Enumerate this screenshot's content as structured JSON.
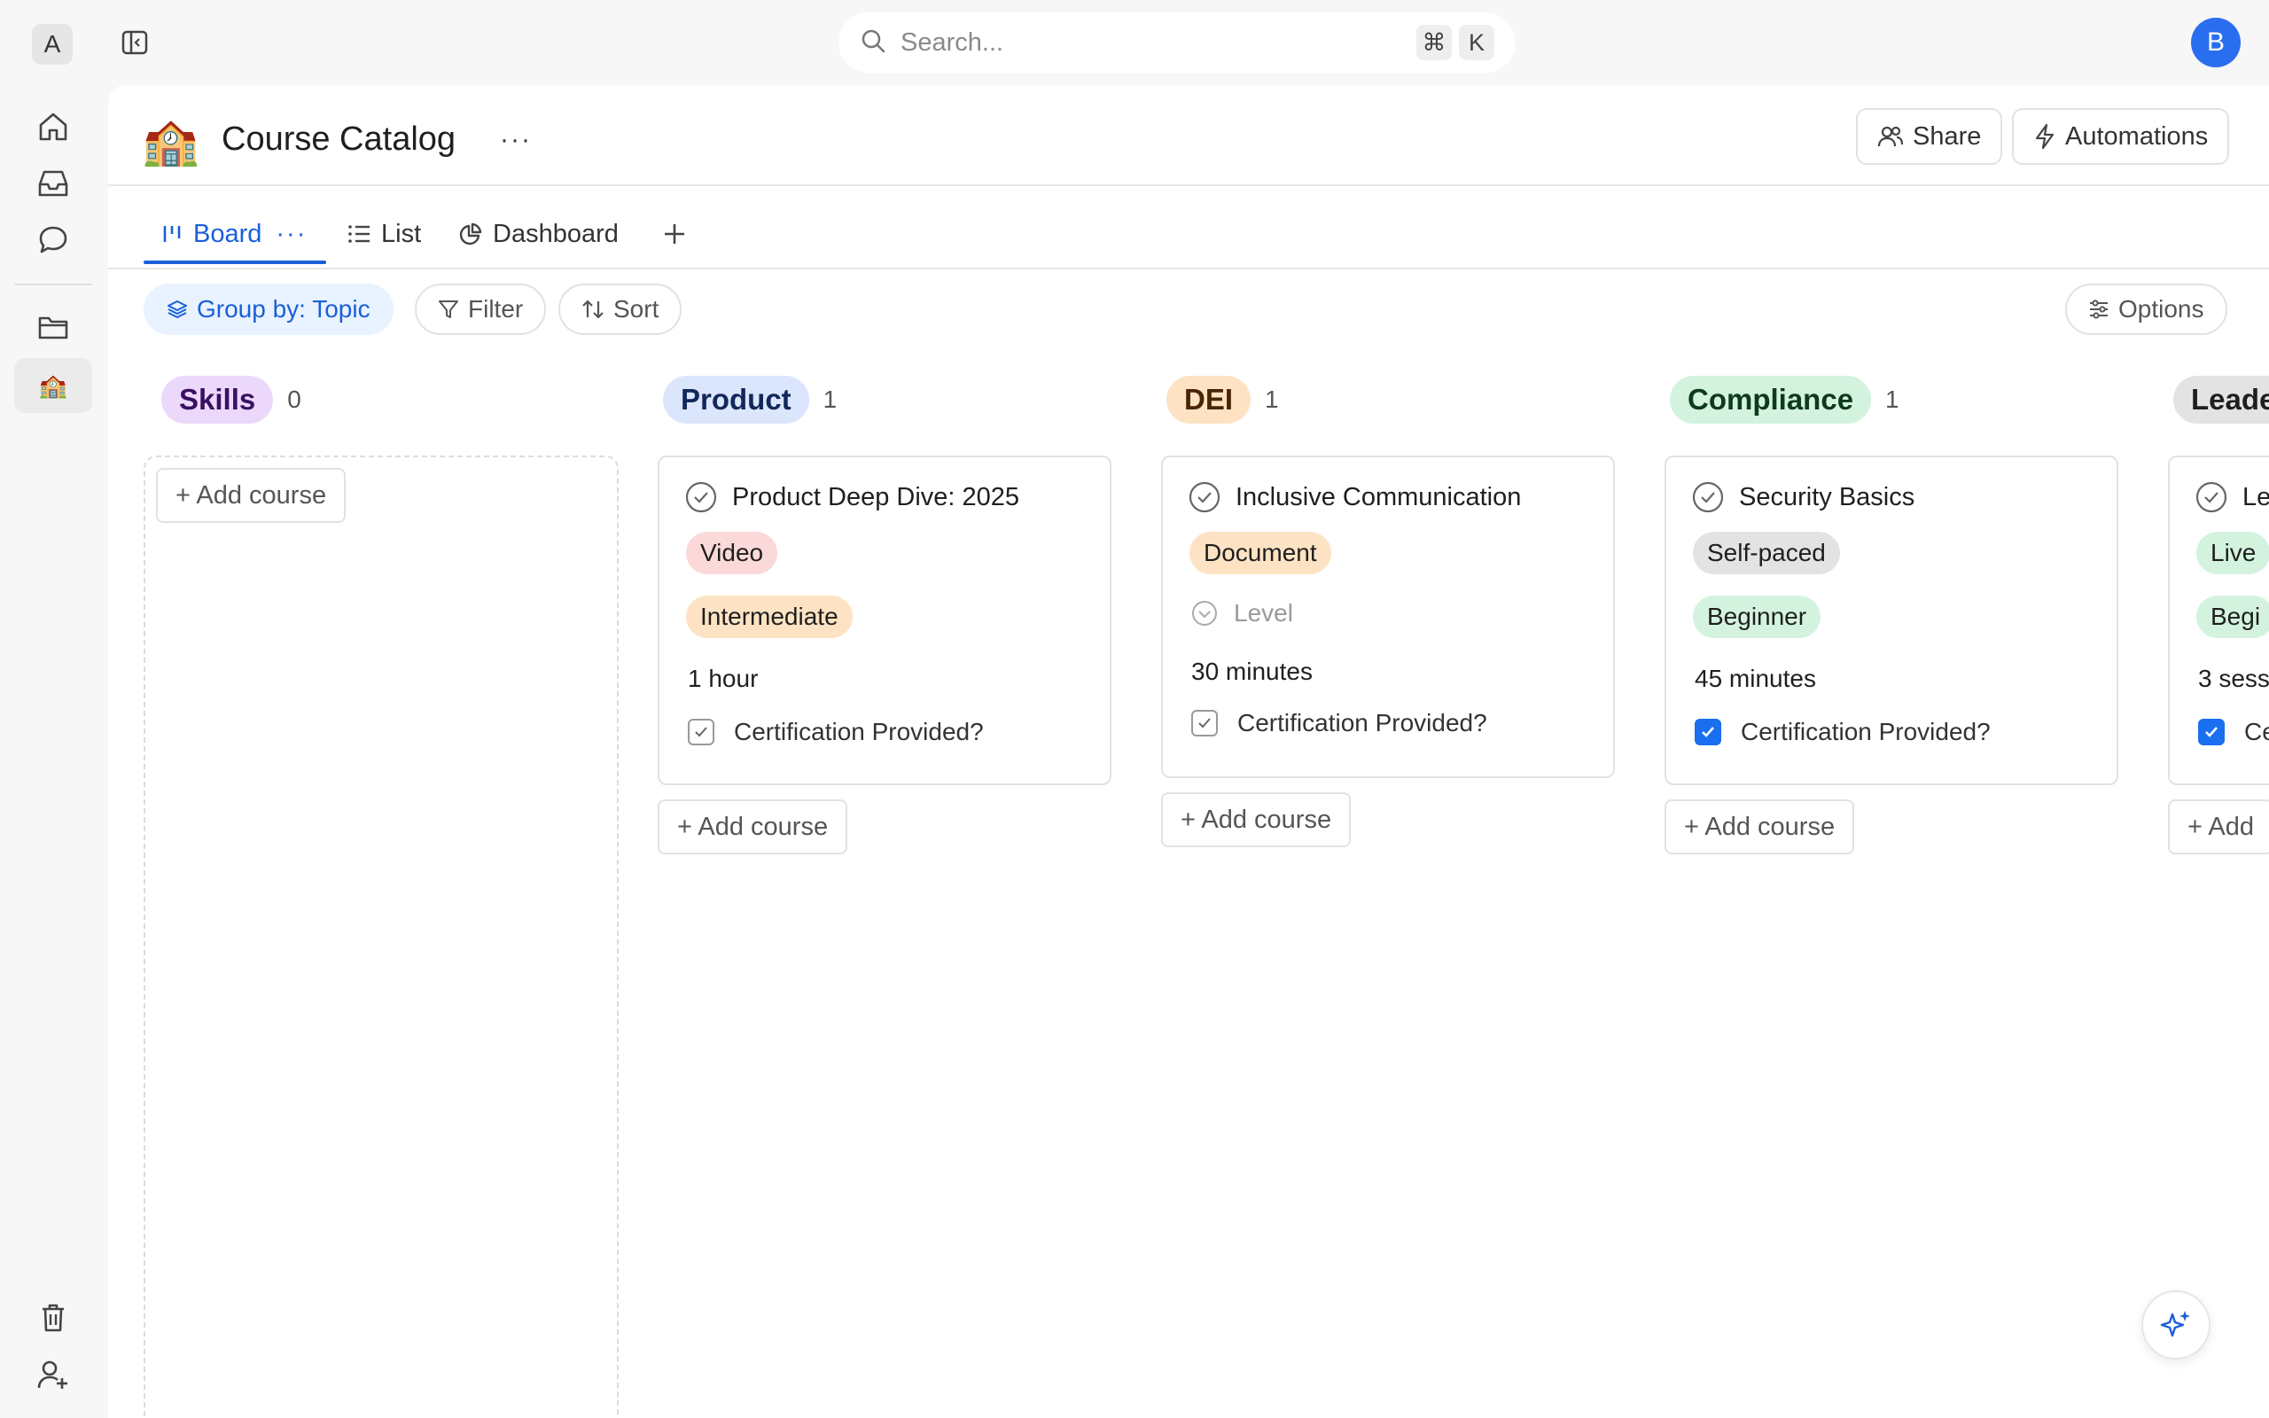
{
  "workspace": {
    "initial": "A"
  },
  "search": {
    "placeholder": "Search...",
    "shortcut_cmd": "⌘",
    "shortcut_key": "K"
  },
  "user": {
    "initial": "B"
  },
  "page": {
    "emoji": "🏫",
    "title": "Course Catalog",
    "more": "···"
  },
  "header_actions": {
    "share": "Share",
    "automations": "Automations"
  },
  "tabs": [
    {
      "label": "Board",
      "active": true
    },
    {
      "label": "List",
      "active": false
    },
    {
      "label": "Dashboard",
      "active": false
    }
  ],
  "tab_more": "···",
  "toolbar": {
    "group_by": "Group by: Topic",
    "filter": "Filter",
    "sort": "Sort",
    "options": "Options"
  },
  "rail": {
    "workspace_emoji": "🏫"
  },
  "columns": [
    {
      "topic": "Skills",
      "count": "0",
      "pill_bg": "#ecd8fb",
      "pill_color": "#3a1160",
      "add_label": "+ Add course"
    },
    {
      "topic": "Product",
      "count": "1",
      "pill_bg": "#dbe6fd",
      "pill_color": "#12285a",
      "card": {
        "title": "Product Deep Dive: 2025",
        "format": "Video",
        "format_bg": "#fbd9d9",
        "level": "Intermediate",
        "level_bg": "#fde3c3",
        "duration": "1 hour",
        "certification_label": "Certification Provided?",
        "certified": false
      },
      "add_label": "+ Add course"
    },
    {
      "topic": "DEI",
      "count": "1",
      "pill_bg": "#fde3c3",
      "pill_color": "#4a2505",
      "card": {
        "title": "Inclusive Communication",
        "format": "Document",
        "format_bg": "#fde3c3",
        "level_placeholder": "Level",
        "duration": "30 minutes",
        "certification_label": "Certification Provided?",
        "certified": false
      },
      "add_label": "+ Add course"
    },
    {
      "topic": "Compliance",
      "count": "1",
      "pill_bg": "#d3f3df",
      "pill_color": "#0e3a20",
      "card": {
        "title": "Security Basics",
        "format": "Self-paced",
        "format_bg": "#e3e3e3",
        "level": "Beginner",
        "level_bg": "#d3f3df",
        "duration": "45 minutes",
        "certification_label": "Certification Provided?",
        "certified": true
      },
      "add_label": "+ Add course"
    },
    {
      "topic": "Leade",
      "pill_bg": "#e3e3e3",
      "pill_color": "#1f1f1f",
      "card": {
        "title": "Le",
        "format": "Live",
        "format_bg": "#d3f3df",
        "level": "Begi",
        "level_bg": "#d3f3df",
        "duration": "3 sess",
        "certification_label": "Ce",
        "certified": true
      },
      "add_label": "+ Add"
    }
  ]
}
